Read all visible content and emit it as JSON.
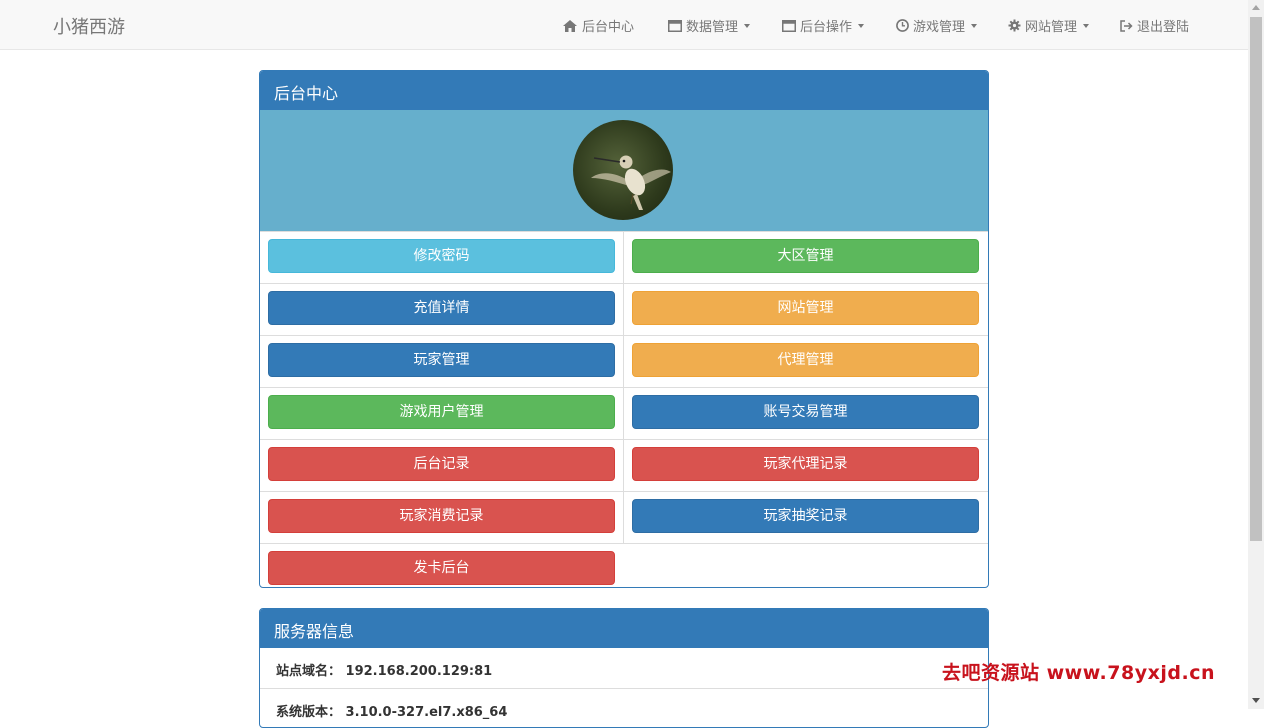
{
  "navbar": {
    "brand": "小猪西游",
    "items": [
      {
        "label": "后台中心",
        "icon": "home-icon"
      },
      {
        "label": "数据管理",
        "icon": "window-icon"
      },
      {
        "label": "后台操作",
        "icon": "window-icon"
      },
      {
        "label": "游戏管理",
        "icon": "clock-icon"
      },
      {
        "label": "网站管理",
        "icon": "gear-icon"
      },
      {
        "label": "退出登陆",
        "icon": "logout-icon"
      }
    ]
  },
  "admin_panel": {
    "title": "后台中心",
    "avatar": "hummingbird-avatar",
    "buttons": [
      {
        "label": "修改密码",
        "color": "#5bc0de"
      },
      {
        "label": "大区管理",
        "color": "#5cb85c"
      },
      {
        "label": "充值详情",
        "color": "#337ab7"
      },
      {
        "label": "网站管理",
        "color": "#f0ad4e"
      },
      {
        "label": "玩家管理",
        "color": "#337ab7"
      },
      {
        "label": "代理管理",
        "color": "#f0ad4e"
      },
      {
        "label": "游戏用户管理",
        "color": "#5cb85c"
      },
      {
        "label": "账号交易管理",
        "color": "#337ab7"
      },
      {
        "label": "后台记录",
        "color": "#d9534f"
      },
      {
        "label": "玩家代理记录",
        "color": "#d9534f"
      },
      {
        "label": "玩家消费记录",
        "color": "#d9534f"
      },
      {
        "label": "玩家抽奖记录",
        "color": "#337ab7"
      },
      {
        "label": "发卡后台",
        "color": "#d9534f"
      }
    ]
  },
  "server_panel": {
    "title": "服务器信息",
    "rows": [
      {
        "label": "站点域名：",
        "value": "192.168.200.129:81"
      },
      {
        "label": "系统版本：",
        "value": "3.10.0-327.el7.x86_64"
      }
    ]
  },
  "watermark": "去吧资源站 www.78yxjd.cn"
}
